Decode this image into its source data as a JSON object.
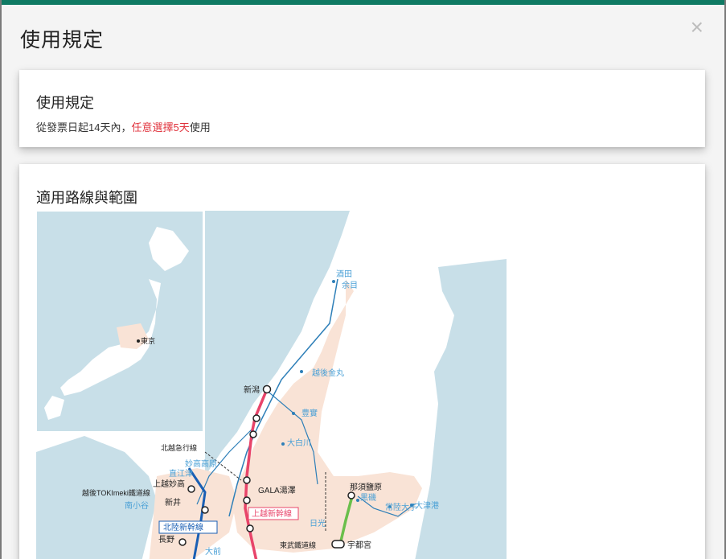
{
  "modal": {
    "title": "使用規定",
    "close_label": "×"
  },
  "rules_card": {
    "title": "使用規定",
    "text_prefix": "從發票日起14天內，",
    "text_highlight": "任意選擇5天",
    "text_suffix": "使用"
  },
  "map_card": {
    "title": "適用路線與範圍",
    "inset_label": "東京",
    "stations_blue": [
      "酒田",
      "余目",
      "越後金丸",
      "豊實",
      "大白川",
      "妙高高原",
      "直江津",
      "南小谷",
      "日光",
      "黒磯",
      "常陸大子",
      "大津港",
      "大前",
      "尾湯"
    ],
    "stations_dark": [
      "新潟",
      "GALA湯澤",
      "越後湯澤",
      "那須鹽原",
      "宇都宮",
      "上越妙高",
      "新井",
      "長野",
      "十日町"
    ],
    "line_labels": [
      "北越急行線",
      "越後TOKImeki鐵道線",
      "東武鐵道線",
      "鬼怒川溫泉",
      "東武日光"
    ],
    "shinkansen_labels": [
      "上越新幹線",
      "北陸新幹線"
    ],
    "colors": {
      "sea": "#c8dfe8",
      "land": "#ffffff",
      "area": "#f9e3d6",
      "joetsu_shinkansen": "#e8446a",
      "hokuriku_shinkansen": "#1a5fb4",
      "tohoku_line": "#6abf4b",
      "jr_line": "#2e7fb8",
      "highlight": "#e0323c",
      "header_bar": "#0f7a63"
    }
  }
}
